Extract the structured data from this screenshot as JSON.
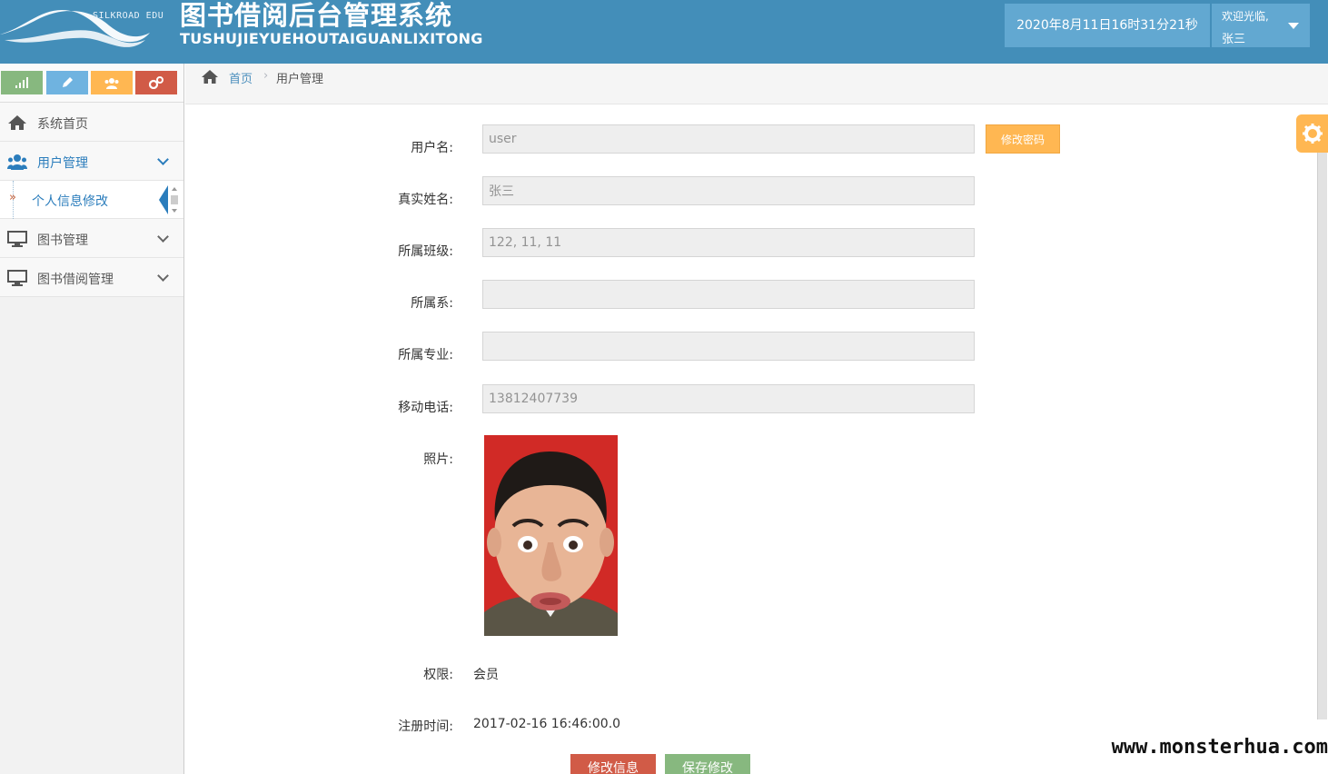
{
  "header": {
    "logo_text": "SILKROAD EDU",
    "title": "图书借阅后台管理系统",
    "subtitle": "TUSHUJIEYUEHOUTAIGUANLIXITONG",
    "datetime": "2020年8月11日16时31分21秒",
    "welcome": "欢迎光临,",
    "username": "张三",
    "bg_color": "#438eb9"
  },
  "shortcuts": [
    {
      "icon": "signal-icon",
      "color": "#87b87f"
    },
    {
      "icon": "pencil-icon",
      "color": "#6fb3e0"
    },
    {
      "icon": "users-icon",
      "color": "#ffb752"
    },
    {
      "icon": "cogs-icon",
      "color": "#d15b47"
    }
  ],
  "sidebar": {
    "items": [
      {
        "label": "系统首页",
        "icon": "home-icon"
      },
      {
        "label": "用户管理",
        "icon": "users-icon",
        "active": true,
        "sub": [
          {
            "label": "个人信息修改",
            "active": true
          }
        ]
      },
      {
        "label": "图书管理",
        "icon": "desktop-icon"
      },
      {
        "label": "图书借阅管理",
        "icon": "desktop-icon"
      }
    ]
  },
  "breadcrumb": {
    "home": "首页",
    "current": "用户管理"
  },
  "form": {
    "username_label": "用户名:",
    "username_value": "user",
    "change_password_label": "修改密码",
    "realname_label": "真实姓名:",
    "realname_value": "张三",
    "class_label": "所属班级:",
    "class_value": "122, 11, 11",
    "dept_label": "所属系:",
    "dept_value": "",
    "major_label": "所属专业:",
    "major_value": "",
    "phone_label": "移动电话:",
    "phone_value": "13812407739",
    "photo_label": "照片:",
    "role_label": "权限:",
    "role_value": "会员",
    "regtime_label": "注册时间:",
    "regtime_value": "2017-02-16 16:46:00.0",
    "edit_button": "修改信息",
    "save_button": "保存修改"
  },
  "watermark": "www.monsterhua.com"
}
